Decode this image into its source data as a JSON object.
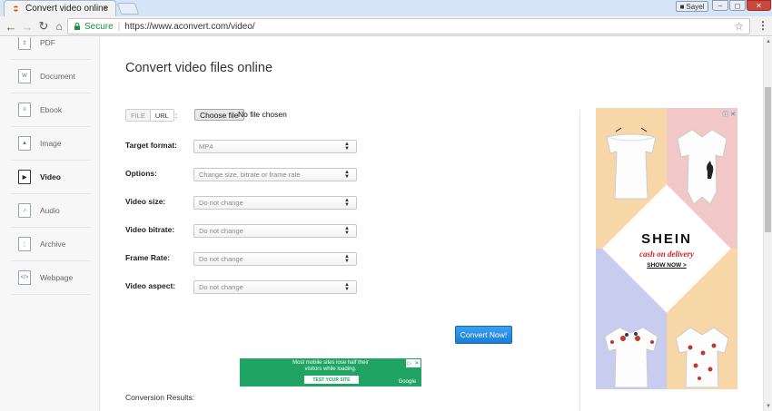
{
  "browser": {
    "tab_title": "Convert video online",
    "tab_close": "×",
    "user_name": "Sayel",
    "secure_label": "Secure",
    "url": "https://www.aconvert.com/video/",
    "separator": "|"
  },
  "sidebar": {
    "items": [
      {
        "label": "PDF",
        "icon": "pdf-file-icon"
      },
      {
        "label": "Document",
        "icon": "word-file-icon"
      },
      {
        "label": "Ebook",
        "icon": "ebook-icon"
      },
      {
        "label": "Image",
        "icon": "image-icon"
      },
      {
        "label": "Video",
        "icon": "video-icon",
        "active": true
      },
      {
        "label": "Audio",
        "icon": "audio-icon"
      },
      {
        "label": "Archive",
        "icon": "archive-icon"
      },
      {
        "label": "Webpage",
        "icon": "webpage-icon"
      }
    ]
  },
  "main": {
    "title": "Convert video files online",
    "source_toggle": {
      "file": "FILE",
      "url": "URL",
      "colon": ":"
    },
    "choose_file": "Choose file",
    "no_file": "No file chosen",
    "form": [
      {
        "label": "Target format:",
        "value": "MP4"
      },
      {
        "label": "Options:",
        "value": "Change size, bitrate or frame rate"
      },
      {
        "label": "Video size:",
        "value": "Do not change"
      },
      {
        "label": "Video bitrate:",
        "value": "Do not change"
      },
      {
        "label": "Frame Rate:",
        "value": "Do not change"
      },
      {
        "label": "Video aspect:",
        "value": "Do not change"
      }
    ],
    "convert_button": "Convert Now!",
    "results_label": "Conversion Results:"
  },
  "ad_banner": {
    "line1": "Most mobile sites lose half their",
    "line2": "visitors while loading.",
    "cta": "TEST YOUR SITE",
    "brand": "Google",
    "color": "#1fa463"
  },
  "side_ad": {
    "brand": "SHEIN",
    "tagline": "cash on delivery",
    "cta": "SHOW NOW >"
  },
  "colors": {
    "accent_button": "#1a7ed8",
    "secure_green": "#1e8e3e"
  }
}
